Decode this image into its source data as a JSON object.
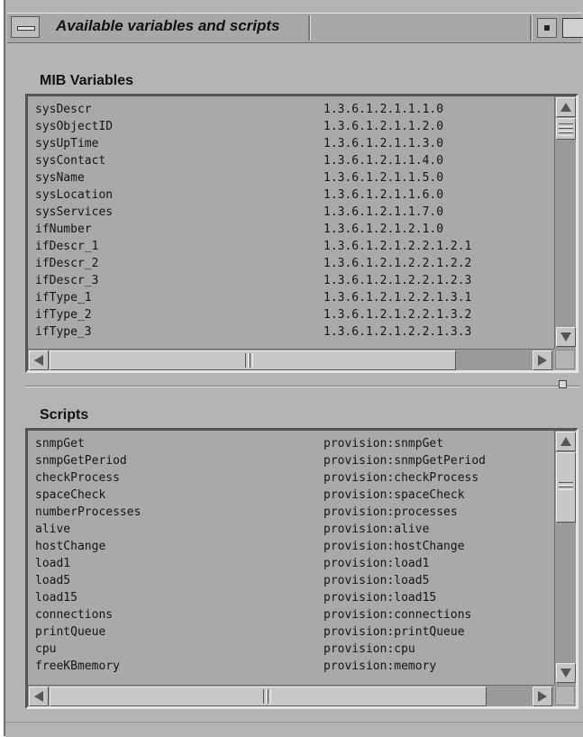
{
  "window": {
    "title": "Available variables and scripts"
  },
  "mib": {
    "label": "MIB Variables",
    "rows": [
      {
        "name": "sysDescr",
        "oid": "1.3.6.1.2.1.1.1.0"
      },
      {
        "name": "sysObjectID",
        "oid": "1.3.6.1.2.1.1.2.0"
      },
      {
        "name": "sysUpTime",
        "oid": "1.3.6.1.2.1.1.3.0"
      },
      {
        "name": "sysContact",
        "oid": "1.3.6.1.2.1.1.4.0"
      },
      {
        "name": "sysName",
        "oid": "1.3.6.1.2.1.1.5.0"
      },
      {
        "name": "sysLocation",
        "oid": "1.3.6.1.2.1.1.6.0"
      },
      {
        "name": "sysServices",
        "oid": "1.3.6.1.2.1.1.7.0"
      },
      {
        "name": "ifNumber",
        "oid": "1.3.6.1.2.1.2.1.0"
      },
      {
        "name": "ifDescr_1",
        "oid": "1.3.6.1.2.1.2.2.1.2.1"
      },
      {
        "name": "ifDescr_2",
        "oid": "1.3.6.1.2.1.2.2.1.2.2"
      },
      {
        "name": "ifDescr_3",
        "oid": "1.3.6.1.2.1.2.2.1.2.3"
      },
      {
        "name": "ifType_1",
        "oid": "1.3.6.1.2.1.2.2.1.3.1"
      },
      {
        "name": "ifType_2",
        "oid": "1.3.6.1.2.1.2.2.1.3.2"
      },
      {
        "name": "ifType_3",
        "oid": "1.3.6.1.2.1.2.2.1.3.3"
      }
    ]
  },
  "scripts": {
    "label": "Scripts",
    "rows": [
      {
        "name": "snmpGet",
        "path": "provision:snmpGet"
      },
      {
        "name": "snmpGetPeriod",
        "path": "provision:snmpGetPeriod"
      },
      {
        "name": "checkProcess",
        "path": "provision:checkProcess"
      },
      {
        "name": "spaceCheck",
        "path": "provision:spaceCheck"
      },
      {
        "name": "numberProcesses",
        "path": "provision:processes"
      },
      {
        "name": "alive",
        "path": "provision:alive"
      },
      {
        "name": "hostChange",
        "path": "provision:hostChange"
      },
      {
        "name": "load1",
        "path": "provision:load1"
      },
      {
        "name": "load5",
        "path": "provision:load5"
      },
      {
        "name": "load15",
        "path": "provision:load15"
      },
      {
        "name": "connections",
        "path": "provision:connections"
      },
      {
        "name": "printQueue",
        "path": "provision:printQueue"
      },
      {
        "name": "cpu",
        "path": "provision:cpu"
      },
      {
        "name": "freeKBmemory",
        "path": "provision:memory"
      }
    ]
  }
}
